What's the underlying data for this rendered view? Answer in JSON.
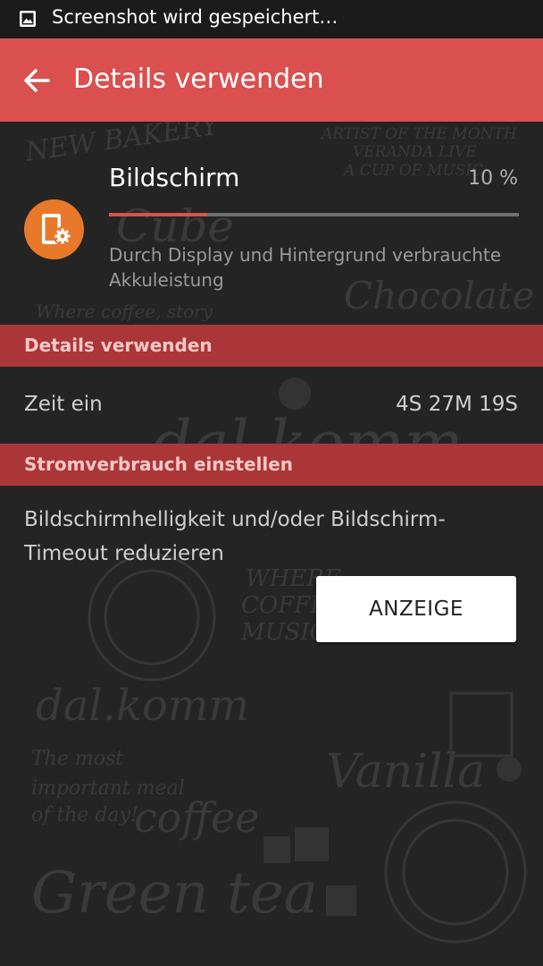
{
  "status_bar": {
    "notification_icon": "image-icon",
    "text": "Screenshot wird gespeichert…"
  },
  "app_bar": {
    "back_icon": "arrow-left-icon",
    "title": "Details verwenden",
    "color": "#d9504f"
  },
  "usage_item": {
    "icon": "screen-settings-icon",
    "icon_color": "#e8792b",
    "title": "Bildschirm",
    "percent_text": "10 %",
    "percent_value": 0.24,
    "description": "Durch Display und Hintergrund verbrauchte Akkuleistung"
  },
  "sections": {
    "details_header": "Details verwenden",
    "power_header": "Stromverbrauch einstellen",
    "header_color": "#ab3638"
  },
  "time_row": {
    "label": "Zeit ein",
    "value": "4S 27M 19S"
  },
  "tip": {
    "text": "Bildschirmhelligkeit und/oder Bildschirm-Timeout reduzieren",
    "button_label": "ANZEIGE"
  }
}
